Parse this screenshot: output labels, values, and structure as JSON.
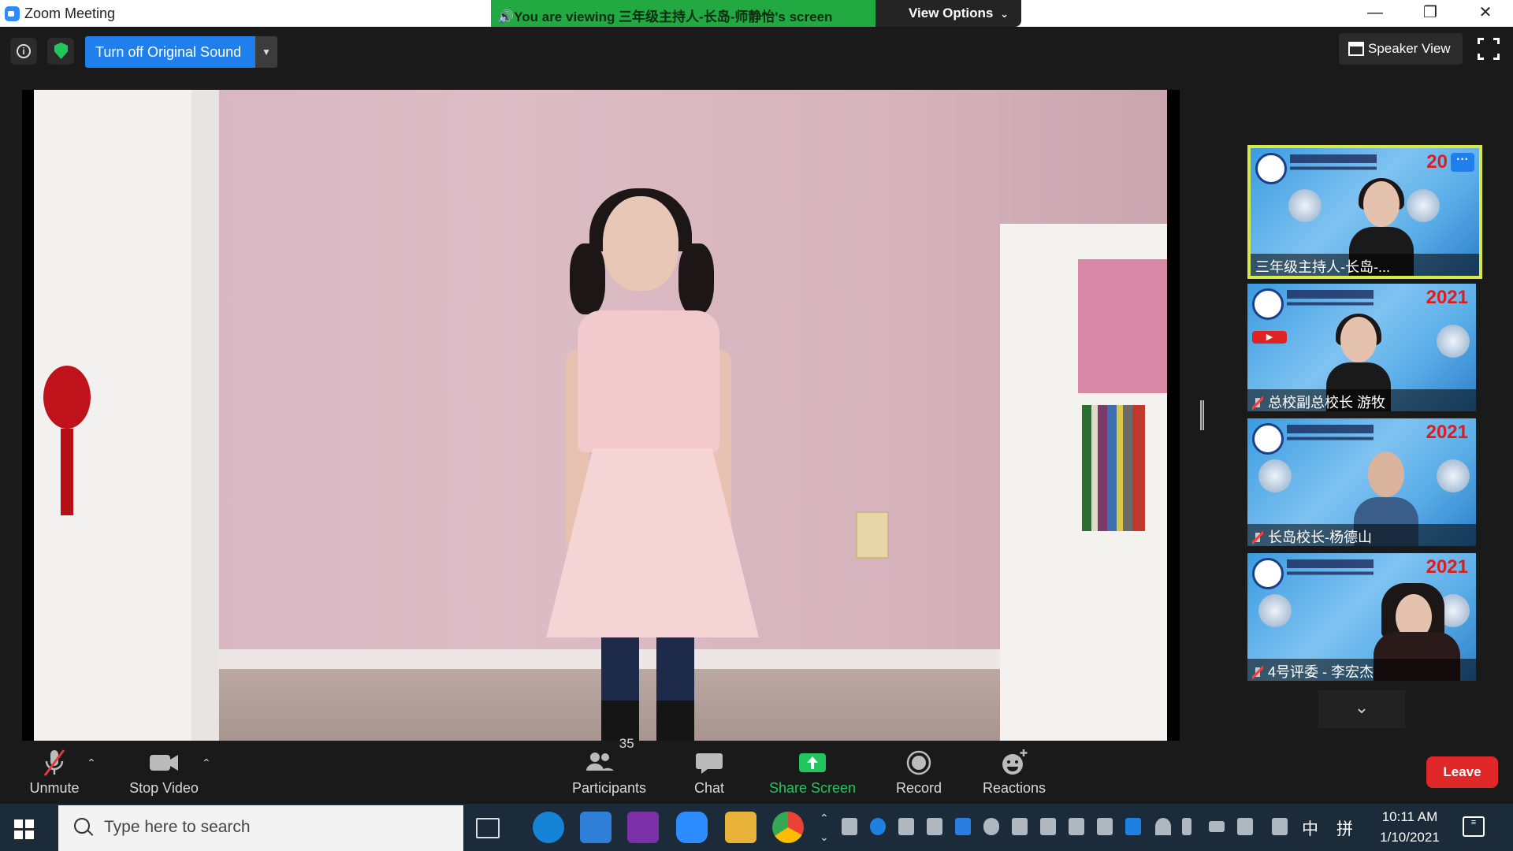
{
  "window": {
    "title": "Zoom Meeting",
    "viewing_banner": "You are viewing 三年级主持人-长岛-师静怡's screen",
    "view_options": "View Options",
    "controls": {
      "minimize": "—",
      "restore": "❐",
      "close": "✕"
    }
  },
  "top_toolbar": {
    "original_sound": "Turn off Original Sound",
    "speaker_view": "Speaker View"
  },
  "thumbnails": [
    {
      "name": "三年级主持人-长岛-...",
      "muted": false,
      "active": true,
      "banner_year": "20"
    },
    {
      "name": "总校副总校长 游牧",
      "muted": true,
      "active": false,
      "banner_year": "2021"
    },
    {
      "name": "长岛校长-杨德山",
      "muted": true,
      "active": false,
      "banner_year": "2021"
    },
    {
      "name": "4号评委 - 李宏杰",
      "muted": true,
      "active": false,
      "banner_year": "2021"
    }
  ],
  "bottom_toolbar": {
    "unmute": "Unmute",
    "stop_video": "Stop Video",
    "participants": "Participants",
    "participants_count": "35",
    "chat": "Chat",
    "share_screen": "Share Screen",
    "record": "Record",
    "reactions": "Reactions",
    "leave": "Leave"
  },
  "taskbar": {
    "search_placeholder": "Type here to search",
    "time": "10:11 AM",
    "date": "1/10/2021",
    "ime_lang": "中",
    "ime_mode": "拼"
  },
  "colors": {
    "banner_green": "#23a942",
    "accent_blue": "#1f7fec",
    "share_green": "#22c55e",
    "leave_red": "#e02828",
    "active_thumb_border": "#d7e84a"
  }
}
